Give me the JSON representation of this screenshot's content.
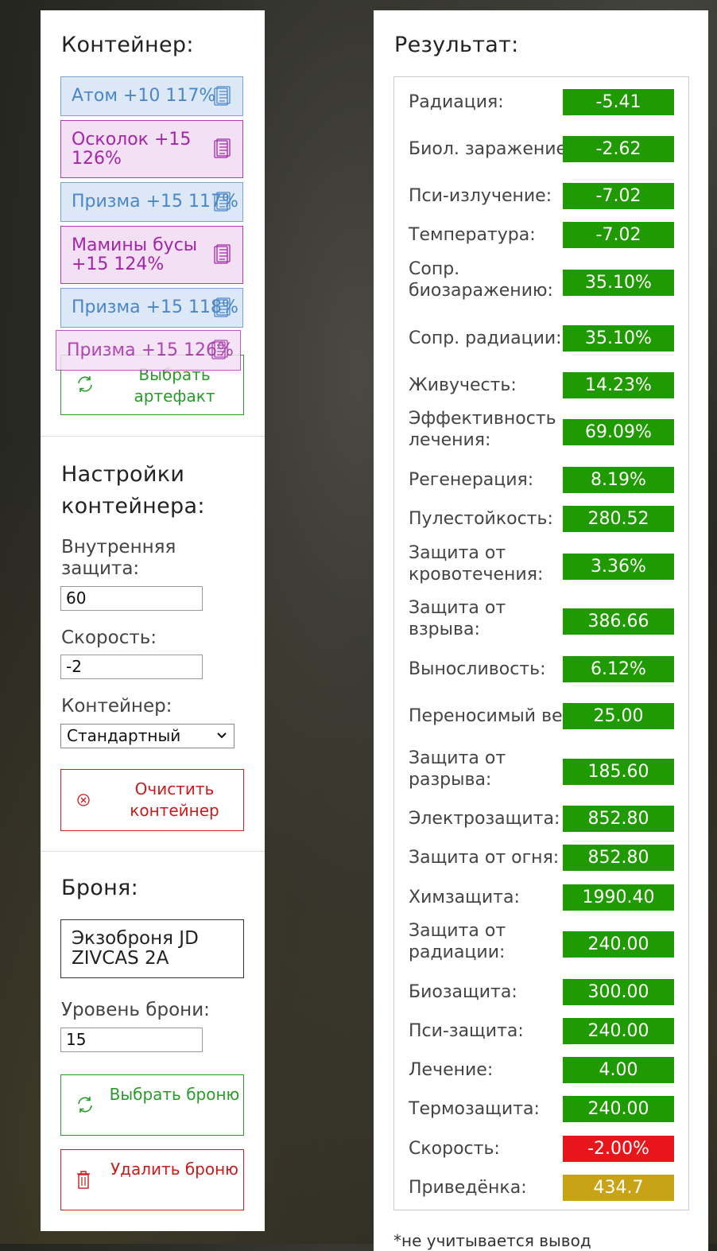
{
  "left": {
    "container_heading": "Контейнер:",
    "artifacts": [
      {
        "text": "Атом +10 117%",
        "color": "blue",
        "lines": 1
      },
      {
        "text": "Осколок +15 126%",
        "color": "purple",
        "lines": 2
      },
      {
        "text": "Призма +15 117%",
        "color": "blue",
        "lines": 1
      },
      {
        "text": "Мамины бусы +15 124%",
        "color": "purple",
        "lines": 2
      },
      {
        "text": "Призма +15 118%",
        "color": "blue",
        "lines": 1
      }
    ],
    "dragging_artifact": {
      "text": "Призма +15 126%",
      "color": "purple"
    },
    "pick_artifact_button": "Выбрать артефакт",
    "settings_heading": "Настройки контейнера:",
    "inner_protection_label": "Внутренняя защита:",
    "inner_protection_value": "60",
    "speed_label": "Скорость:",
    "speed_value": "-2",
    "container_type_label": "Контейнер:",
    "container_type_value": "Стандартный",
    "clear_container_button": "Очистить контейнер",
    "armor_heading": "Броня:",
    "armor_name": "Экзоброня JD ZIVCAS 2A",
    "armor_level_label": "Уровень брони:",
    "armor_level_value": "15",
    "pick_armor_button": "Выбрать броню",
    "remove_armor_button": "Удалить броню"
  },
  "right": {
    "heading": "Результат:",
    "rows": [
      {
        "label": "Радиация:",
        "value": "-5.41",
        "color": "#1f9a00"
      },
      {
        "label": "Биол. заражение:",
        "value": "-2.62",
        "color": "#1f9a00"
      },
      {
        "label": "Пси-излучение:",
        "value": "-7.02",
        "color": "#1f9a00"
      },
      {
        "label": "Температура:",
        "value": "-7.02",
        "color": "#1f9a00"
      },
      {
        "label": "Сопр. биозаражению:",
        "value": "35.10%",
        "color": "#1f9a00"
      },
      {
        "label": "Сопр. радиации:",
        "value": "35.10%",
        "color": "#1f9a00"
      },
      {
        "label": "Живучесть:",
        "value": "14.23%",
        "color": "#1f9a00"
      },
      {
        "label": "Эффективность лечения:",
        "value": "69.09%",
        "color": "#1f9a00"
      },
      {
        "label": "Регенерация:",
        "value": "8.19%",
        "color": "#1f9a00"
      },
      {
        "label": "Пулестойкость:",
        "value": "280.52",
        "color": "#1f9a00"
      },
      {
        "label": "Защита от кровотечения:",
        "value": "3.36%",
        "color": "#1f9a00"
      },
      {
        "label": "Защита от взрыва:",
        "value": "386.66",
        "color": "#1f9a00"
      },
      {
        "label": "Выносливость:",
        "value": "6.12%",
        "color": "#1f9a00"
      },
      {
        "label": "Переносимый вес:",
        "value": "25.00",
        "color": "#1f9a00"
      },
      {
        "label": "Защита от разрыва:",
        "value": "185.60",
        "color": "#1f9a00"
      },
      {
        "label": "Электрозащита:",
        "value": "852.80",
        "color": "#1f9a00"
      },
      {
        "label": "Защита от огня:",
        "value": "852.80",
        "color": "#1f9a00"
      },
      {
        "label": "Химзащита:",
        "value": "1990.40",
        "color": "#1f9a00"
      },
      {
        "label": "Защита от радиации:",
        "value": "240.00",
        "color": "#1f9a00"
      },
      {
        "label": "Биозащита:",
        "value": "300.00",
        "color": "#1f9a00"
      },
      {
        "label": "Пси-защита:",
        "value": "240.00",
        "color": "#1f9a00"
      },
      {
        "label": "Лечение:",
        "value": "4.00",
        "color": "#1f9a00"
      },
      {
        "label": "Термозащита:",
        "value": "240.00",
        "color": "#1f9a00"
      },
      {
        "label": "Скорость:",
        "value": "-2.00%",
        "color": "#e8151b"
      },
      {
        "label": "Приведёнка:",
        "value": "434.7",
        "color": "#c9a316"
      }
    ],
    "footnote": "*не учитывается вывод"
  }
}
